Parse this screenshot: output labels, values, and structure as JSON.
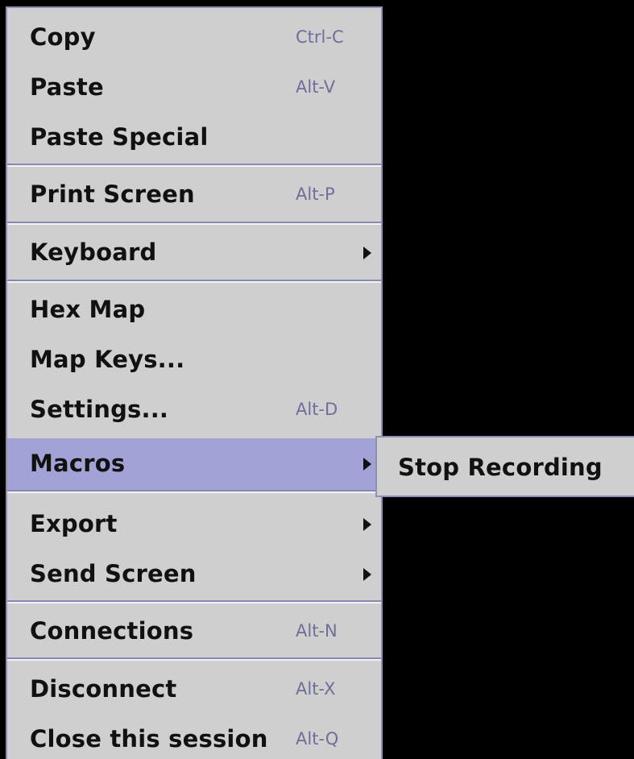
{
  "menu": {
    "items": [
      {
        "label": "Copy",
        "accelerator": "Ctrl-C",
        "submenu": false
      },
      {
        "label": "Paste",
        "accelerator": "Alt-V",
        "submenu": false
      },
      {
        "label": "Paste Special",
        "accelerator": "",
        "submenu": false
      },
      {
        "label": "Print Screen",
        "accelerator": "Alt-P",
        "submenu": false
      },
      {
        "label": "Keyboard",
        "accelerator": "",
        "submenu": true
      },
      {
        "label": "Hex Map",
        "accelerator": "",
        "submenu": false
      },
      {
        "label": "Map Keys...",
        "accelerator": "",
        "submenu": false
      },
      {
        "label": "Settings...",
        "accelerator": "Alt-D",
        "submenu": false
      },
      {
        "label": "Macros",
        "accelerator": "",
        "submenu": true,
        "selected": true
      },
      {
        "label": "Export",
        "accelerator": "",
        "submenu": true
      },
      {
        "label": "Send Screen",
        "accelerator": "",
        "submenu": true
      },
      {
        "label": "Connections",
        "accelerator": "Alt-N",
        "submenu": false
      },
      {
        "label": "Disconnect",
        "accelerator": "Alt-X",
        "submenu": false
      },
      {
        "label": "Close this session",
        "accelerator": "Alt-Q",
        "submenu": false
      }
    ]
  },
  "submenu": {
    "parent": "Macros",
    "items": [
      {
        "label": "Stop Recording"
      }
    ]
  },
  "colors": {
    "menu_background": "#cfcfcf",
    "selected_background": "#a3a2d6",
    "accelerator_text": "#6e6e9a",
    "border": "#8e8eb6",
    "desktop_background": "#000000"
  }
}
